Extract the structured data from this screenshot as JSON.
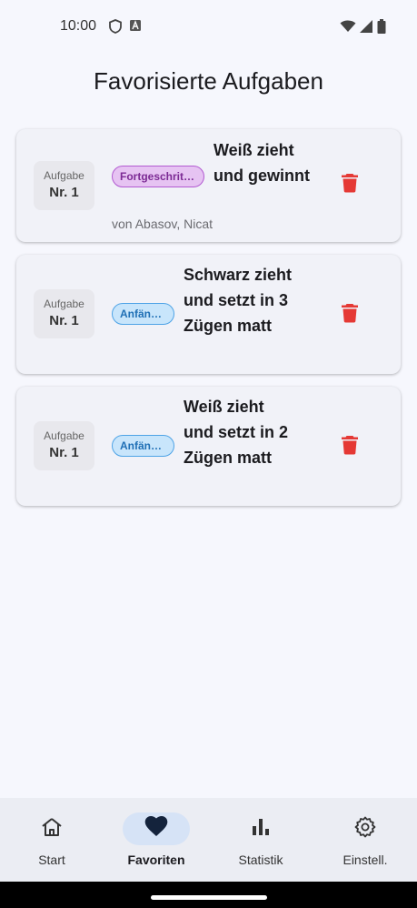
{
  "status_bar": {
    "time": "10:00"
  },
  "page": {
    "title": "Favorisierte Aufgaben"
  },
  "cards": [
    {
      "nr_label": "Aufgabe",
      "nr_value": "Nr. 1",
      "badge": "Fortgeschritt…",
      "title": "Weiß zieht und gewinnt",
      "author": "von Abasov, Nicat"
    },
    {
      "nr_label": "Aufgabe",
      "nr_value": "Nr. 1",
      "badge": "Anfänger",
      "title": "Schwarz zieht und setzt in 3 Zügen matt"
    },
    {
      "nr_label": "Aufgabe",
      "nr_value": "Nr. 1",
      "badge": "Anfänger",
      "title": "Weiß zieht und setzt in 2 Zügen matt"
    }
  ],
  "nav": {
    "items": [
      {
        "label": "Start",
        "icon": "home-icon"
      },
      {
        "label": "Favoriten",
        "icon": "heart-icon"
      },
      {
        "label": "Statistik",
        "icon": "bar-chart-icon"
      },
      {
        "label": "Einstell.",
        "icon": "gear-icon"
      }
    ],
    "active": "Favoriten"
  },
  "colors": {
    "delete": "#e53935",
    "advanced_badge": "#e6c3f2",
    "beginner_badge": "#c8e5fb",
    "nav_active": "#d6e3f6"
  }
}
